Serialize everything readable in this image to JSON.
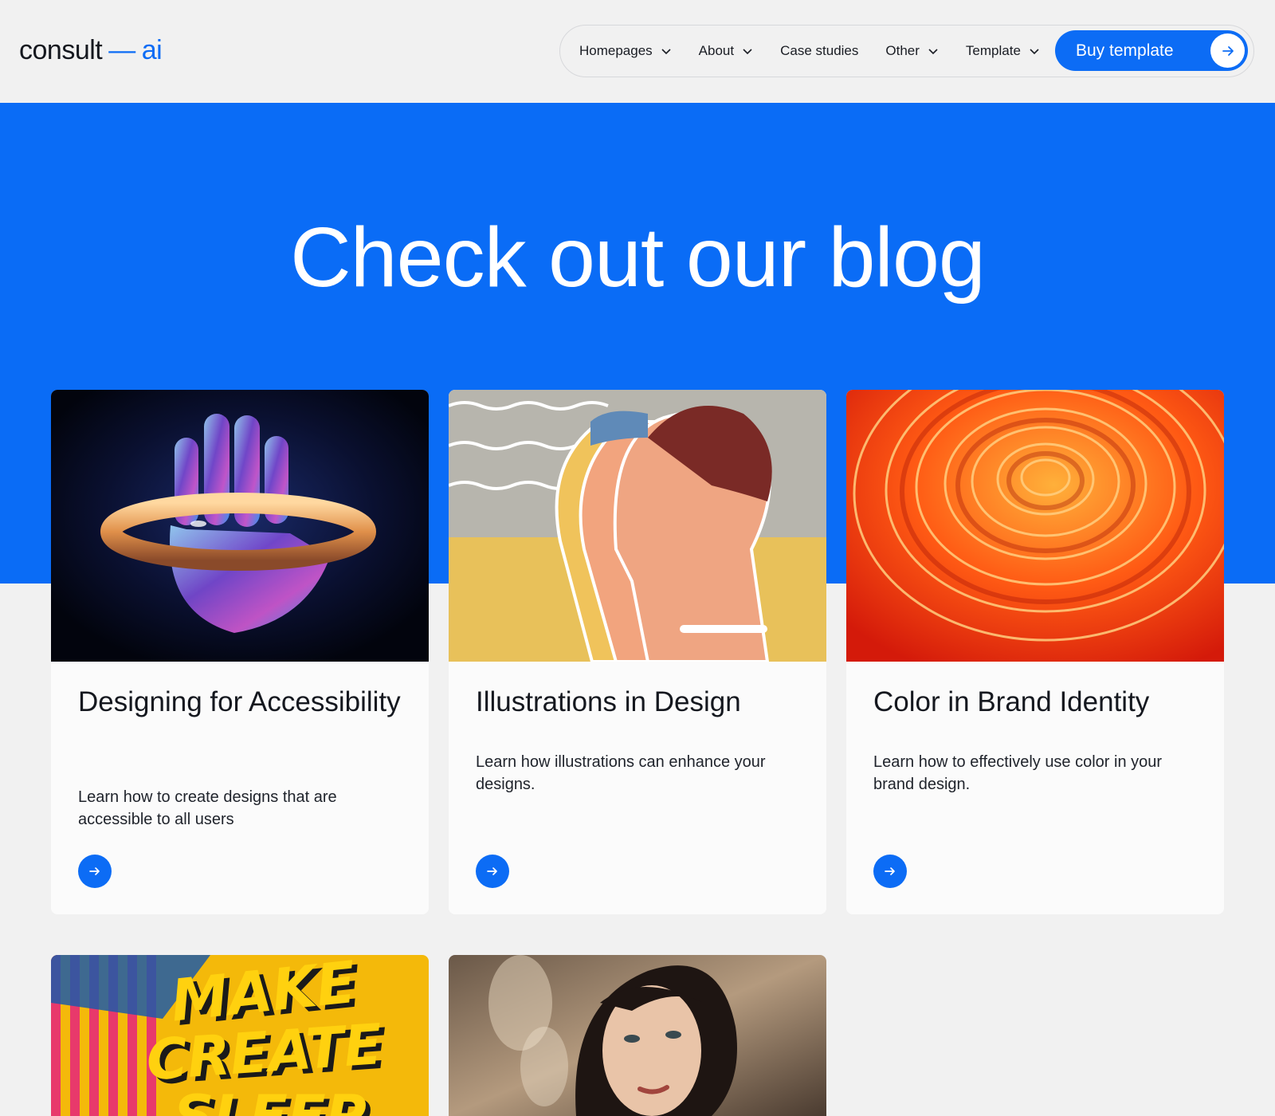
{
  "brand": {
    "logo_left": "consult",
    "logo_dash": "—",
    "logo_right": "ai",
    "accent": "#0c6cf5"
  },
  "nav": {
    "items": [
      {
        "label": "Homepages",
        "has_dropdown": true
      },
      {
        "label": "About",
        "has_dropdown": true
      },
      {
        "label": "Case studies",
        "has_dropdown": false
      },
      {
        "label": "Other",
        "has_dropdown": true
      },
      {
        "label": "Template",
        "has_dropdown": true
      }
    ],
    "cta_label": "Buy template"
  },
  "hero": {
    "title": "Check out our blog"
  },
  "posts": [
    {
      "title": "Designing for Accessibility",
      "description": "Learn how to create designs that are accessible to all users",
      "image": "glass-hand-ring"
    },
    {
      "title": "Illustrations in Design",
      "description": "Learn how illustrations can enhance your designs.",
      "image": "retro-beach-poster"
    },
    {
      "title": "Color in Brand Identity",
      "description": "Learn how to effectively use color in your brand design.",
      "image": "orange-paper-swirl"
    },
    {
      "title": "",
      "description": "",
      "image": "make-create-sleep-type",
      "image_text": [
        "MAKE",
        "CREATE",
        "SLEEP"
      ]
    },
    {
      "title": "",
      "description": "",
      "image": "woman-portrait"
    }
  ]
}
